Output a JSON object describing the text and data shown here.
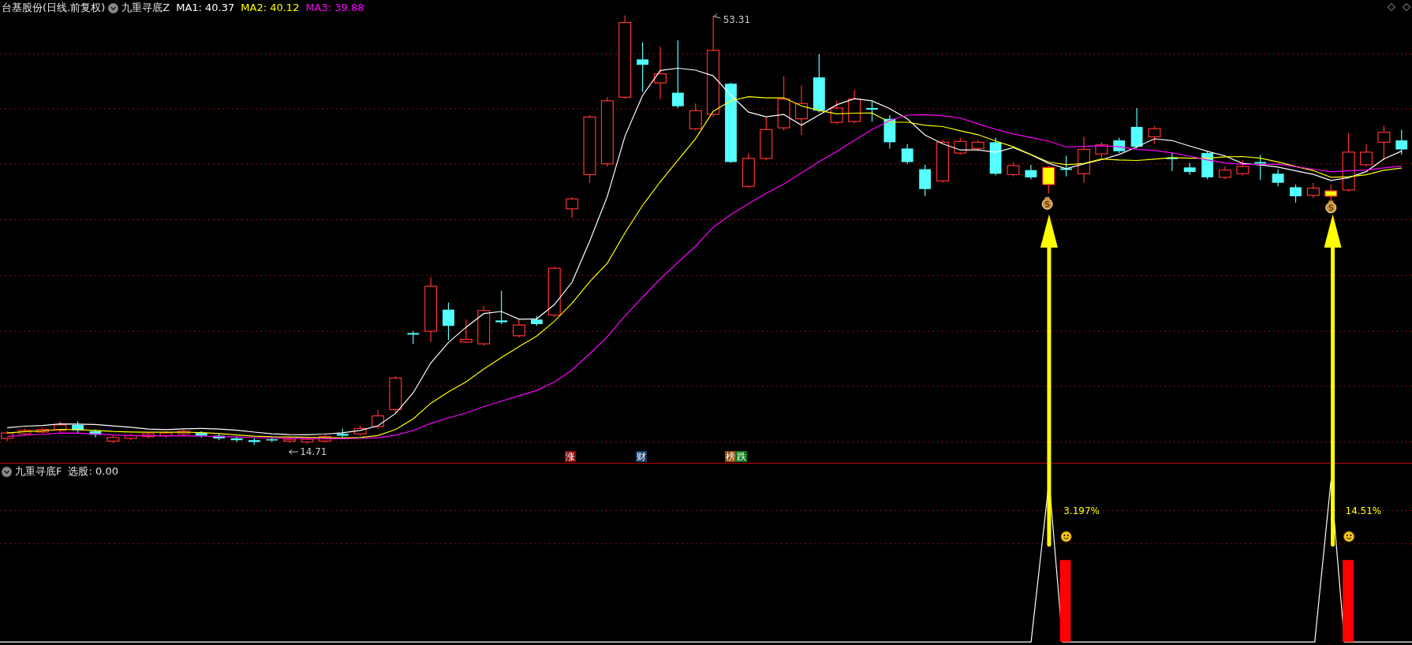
{
  "price_panel": {
    "stock": "台基股份(日线.前复权)",
    "indicator": "九重寻底Z",
    "ma": [
      {
        "label": "MA1: 40.37",
        "color": "#ffffff"
      },
      {
        "label": "MA2: 40.12",
        "color": "#ffff00"
      },
      {
        "label": "MA3: 39.88",
        "color": "#ff00ff"
      }
    ],
    "high_label": "53.31",
    "low_label": "14.71",
    "tags": [
      {
        "text": "涨",
        "color": "#8b0a0a"
      },
      {
        "text": "财",
        "color": "#1c3f66"
      },
      {
        "text": "榜",
        "color": "#8a4a0a"
      },
      {
        "text": "跌",
        "color": "#0a7a1a"
      }
    ]
  },
  "signal_panel": {
    "indicator": "九重寻底F",
    "value": "选股: 0.00",
    "signals": [
      {
        "pct": "3.197%"
      },
      {
        "pct": "14.51%"
      }
    ]
  }
}
